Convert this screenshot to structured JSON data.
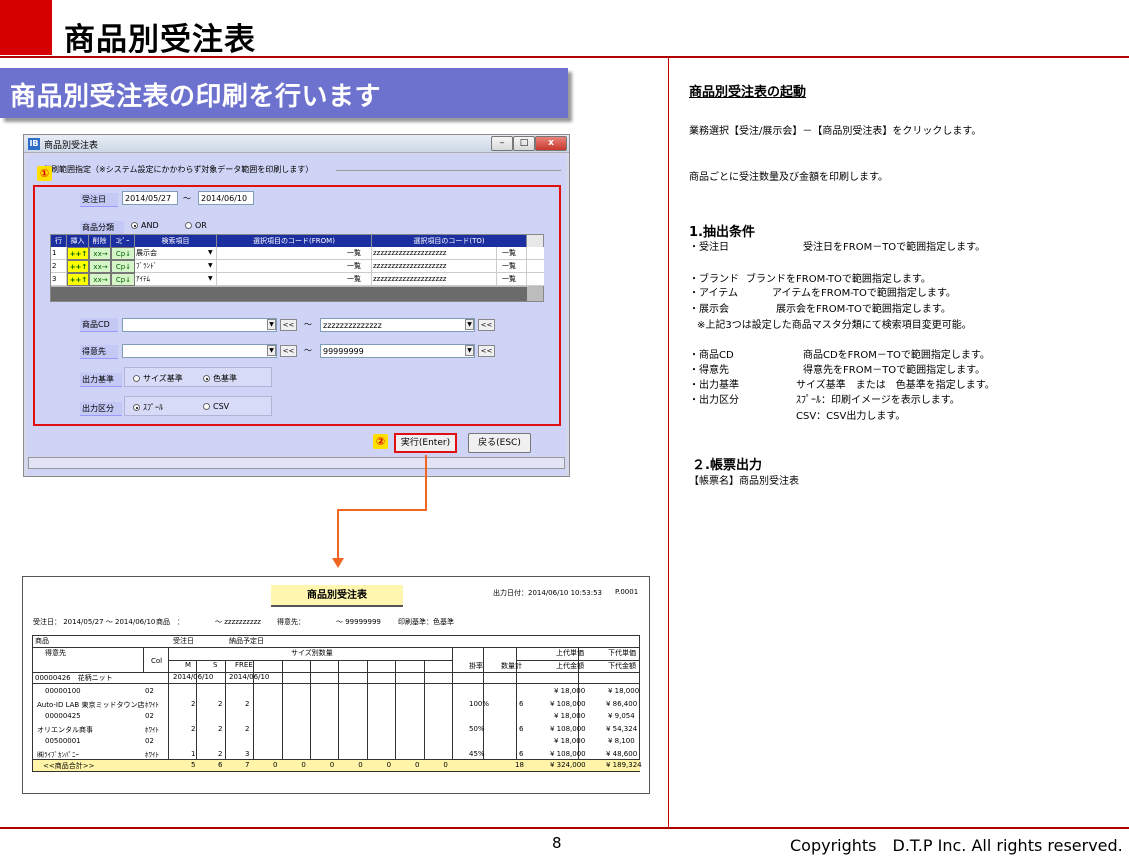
{
  "header": {
    "title": "商品別受注表"
  },
  "banner": {
    "text": "商品別受注表の印刷を行います"
  },
  "dialog": {
    "title": "商品別受注表",
    "group_label": "印刷範囲指定（※システム設定にかかわらず対象データ範囲を印刷します）",
    "marker1": "①",
    "marker2": "②",
    "order_date_label": "受注日",
    "order_date_from": "2014/05/27",
    "tilde": "～",
    "order_date_to": "2014/06/10",
    "category_label": "商品分類",
    "and_label": "AND",
    "or_label": "OR",
    "table_headers": [
      "行",
      "挿入",
      "削除",
      "ｺﾋﾟｰ",
      "検索項目",
      "選択項目のコード(FROM)",
      "選択項目のコード(TO)"
    ],
    "rows": [
      {
        "no": "1",
        "ins": "++↑",
        "del": "xx→",
        "cp": "Cp↓",
        "item": "展示会",
        "list": "一覧",
        "to": "zzzzzzzzzzzzzzzzzzzz",
        "list2": "一覧"
      },
      {
        "no": "2",
        "ins": "++↑",
        "del": "xx→",
        "cp": "Cp↓",
        "item": "ﾌﾞﾗﾝﾄﾞ",
        "list": "一覧",
        "to": "zzzzzzzzzzzzzzzzzzzz",
        "list2": "一覧"
      },
      {
        "no": "3",
        "ins": "++↑",
        "del": "xx→",
        "cp": "Cp↓",
        "item": "ｱｲﾃﾑ",
        "list": "一覧",
        "to": "zzzzzzzzzzzzzzzzzzzz",
        "list2": "一覧"
      }
    ],
    "product_cd_label": "商品CD",
    "product_cd_to": "zzzzzzzzzzzzzz",
    "customer_label": "得意先",
    "customer_to": "99999999",
    "back_arrows": "<<",
    "output_basis_label": "出力基準",
    "size_basis": "サイズ基準",
    "color_basis": "色基準",
    "output_type_label": "出力区分",
    "spool": "ｽﾌﾟｰﾙ",
    "csv": "CSV",
    "run_button": "実行(Enter)",
    "back_button": "戻る(ESC)",
    "win_min": "–",
    "win_max": "□",
    "win_close": "x"
  },
  "report": {
    "title": "商品別受注表",
    "output_date": "出力日付：2014/06/10 10:53:53",
    "page": "P.0001",
    "cond_date": "受注日： 2014/05/27 ～ 2014/06/10",
    "cond_product": "商品　：",
    "cond_product_to": "～ zzzzzzzzzz",
    "cond_customer": "得意先：",
    "cond_customer_to": "～ 99999999",
    "cond_basis": "印刷基準：色基準",
    "h_product": "商品",
    "h_orderdate": "受注日",
    "h_deliv": "納品予定日",
    "h_customer": "得意先",
    "h_col": "Col",
    "h_size": "サイズ別数量",
    "h_m": "M",
    "h_s": "S",
    "h_free": "FREE",
    "h_rate": "掛率",
    "h_qty": "数量計",
    "h_upper_price": "上代単価",
    "h_lower_price": "下代単価",
    "h_upper_amt": "上代金額",
    "h_lower_amt": "下代金額",
    "group_code": "00000426　花柄ニット",
    "group_date": "2014/06/10",
    "group_deliv": "2014/06/10",
    "lines": [
      {
        "code": "00000100",
        "name": "Auto-ID LAB 東京ミッドタウン店",
        "col": "02",
        "colname": "ﾎﾜｲﾄ",
        "m": "2",
        "s": "2",
        "free": "2",
        "rate": "100%",
        "qty": "6",
        "up": "¥ 18,000",
        "low": "¥ 18,000",
        "upamt": "¥ 108,000",
        "lowamt": "¥ 86,400"
      },
      {
        "code": "00000425",
        "name": "オリエンタル商事",
        "col": "02",
        "colname": "ﾎﾜｲﾄ",
        "m": "2",
        "s": "2",
        "free": "2",
        "rate": "50%",
        "qty": "6",
        "up": "¥ 18,000",
        "low": "¥ 9,054",
        "upamt": "¥ 108,000",
        "lowamt": "¥ 54,324"
      },
      {
        "code": "00500001",
        "name": "㈱ﾗｲﾌﾞｶﾝﾊﾟﾆｰ",
        "col": "02",
        "colname": "ﾎﾜｲﾄ",
        "m": "1",
        "s": "2",
        "free": "3",
        "rate": "45%",
        "qty": "6",
        "up": "¥ 18,000",
        "low": "¥ 8,100",
        "upamt": "¥ 108,000",
        "lowamt": "¥ 48,600"
      }
    ],
    "total_label": "<<商品合計>>",
    "total_m": "5",
    "total_s": "6",
    "total_free": "7",
    "total_zero": "0",
    "total_qty": "18",
    "total_upamt": "¥ 324,000",
    "total_lowamt": "¥ 189,324"
  },
  "right": {
    "heading": "商品別受注表の起動",
    "line1": "業務選択【受注/展示会】－【商品別受注表】をクリックします。",
    "line2": "商品ごとに受注数量及び金額を印刷します。",
    "sec1": "1.抽出条件",
    "s1_items": [
      [
        "・受注日",
        "受注日をFROM－TOで範囲指定します。"
      ],
      [
        "・ブランド",
        "ブランドをFROM-TOで範囲指定します。"
      ],
      [
        "・アイテム",
        "アイテムをFROM-TOで範囲指定します。"
      ],
      [
        "・展示会",
        "展示会をFROM-TOで範囲指定します。"
      ]
    ],
    "note": "※上記3つは設定した商品マスタ分類にて検索項目変更可能。",
    "s2_items": [
      [
        "・商品CD",
        "商品CDをFROM－TOで範囲指定します。"
      ],
      [
        "・得意先",
        "得意先をFROM－TOで範囲指定します。"
      ],
      [
        "・出力基準",
        "サイズ基準　または　色基準を指定します。"
      ],
      [
        "・出力区分",
        "ｽﾌﾟｰﾙ：印刷イメージを表示します。"
      ]
    ],
    "csv_line": "CSV：CSV出力します。",
    "sec2": "２.帳票出力",
    "form_name": "【帳票名】商品別受注表"
  },
  "footer": {
    "page": "8",
    "copyright": "Copyrights　D.T.P Inc. All rights reserved."
  }
}
